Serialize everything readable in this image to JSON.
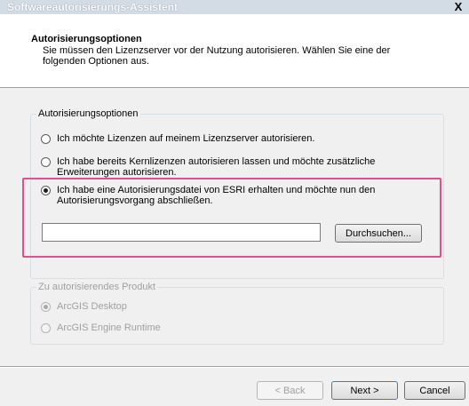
{
  "window": {
    "title": "Softwareautorisierungs-Assistent",
    "close_glyph": "X"
  },
  "header": {
    "title": "Autorisierungsoptionen",
    "description": "Sie müssen den Lizenzserver vor der Nutzung autorisieren. Wählen Sie eine der folgenden Optionen aus."
  },
  "auth_group": {
    "legend": "Autorisierungsoptionen",
    "options": [
      {
        "label": "Ich möchte Lizenzen auf meinem Lizenzserver autorisieren.",
        "checked": false
      },
      {
        "label": "Ich habe bereits Kernlizenzen autorisieren lassen und möchte zusätzliche Erweiterungen autorisieren.",
        "checked": false
      },
      {
        "label": "Ich habe eine Autorisierungsdatei von ESRI erhalten und möchte nun den Autorisierungsvorgang abschließen.",
        "checked": true
      }
    ],
    "file_path_value": "",
    "browse_label": "Durchsuchen..."
  },
  "product_group": {
    "legend": "Zu autorisierendes Produkt",
    "options": [
      {
        "label": "ArcGIS Desktop",
        "checked": true,
        "disabled": true
      },
      {
        "label": "ArcGIS Engine Runtime",
        "checked": false,
        "disabled": true
      }
    ]
  },
  "footer": {
    "back_label": "< Back",
    "next_label": "Next >",
    "cancel_label": "Cancel"
  },
  "colors": {
    "highlight": "#e0508a",
    "titlebar": "#d3dbe5"
  }
}
